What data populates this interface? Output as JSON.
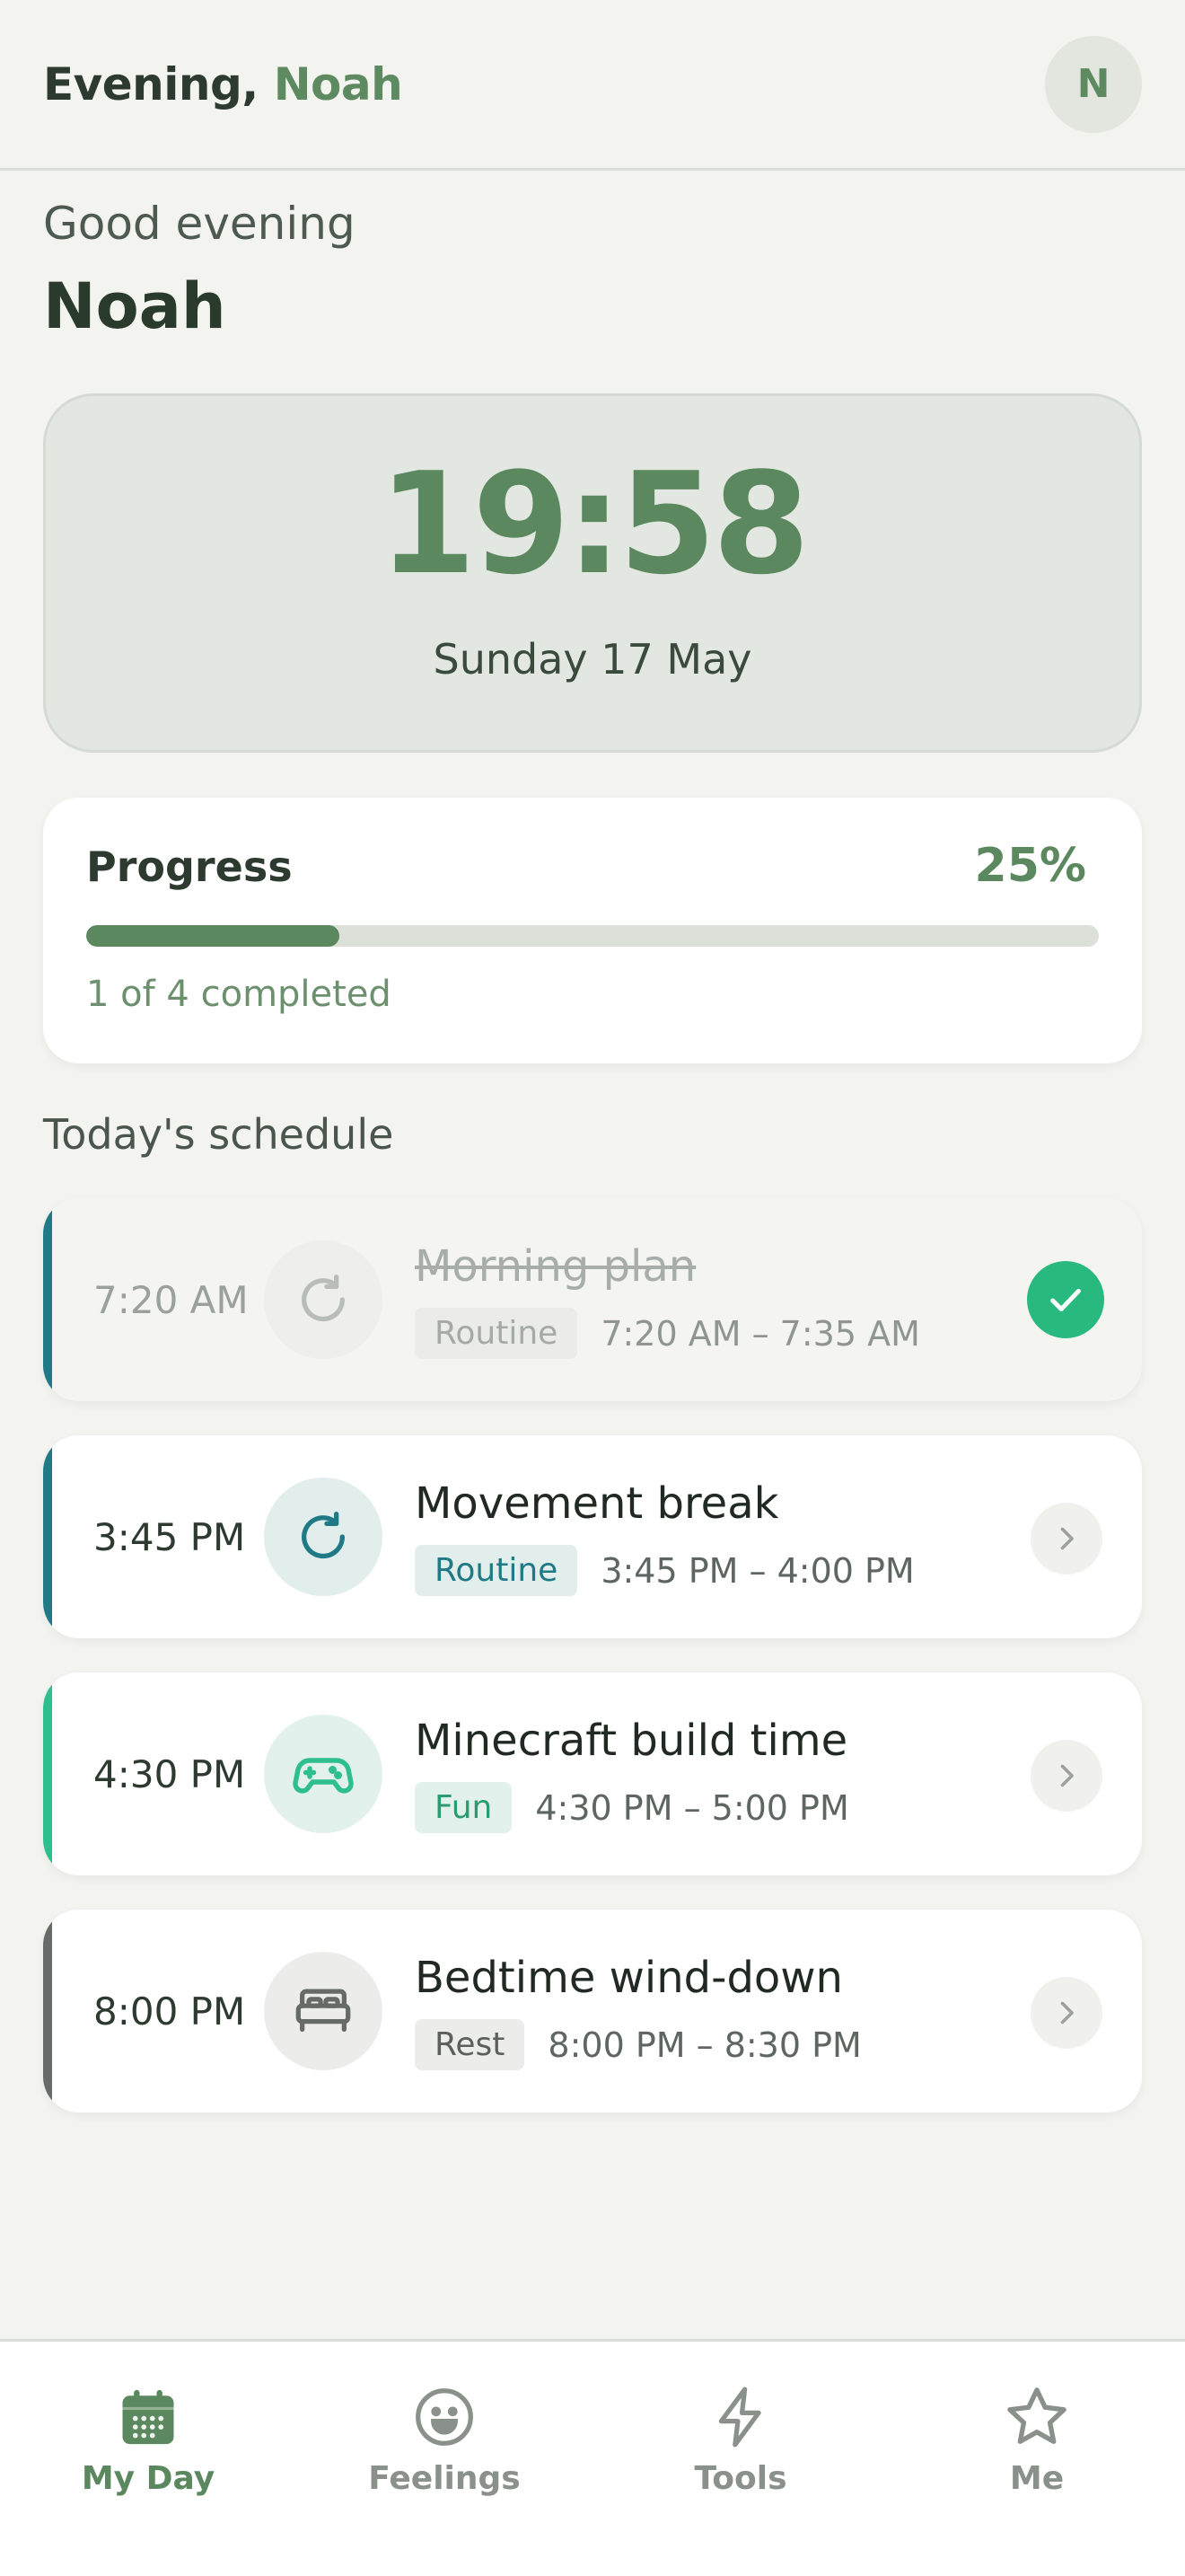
{
  "header": {
    "greeting_prefix": "Evening, ",
    "user_name": "Noah",
    "avatar_initial": "N"
  },
  "greeting": {
    "subtitle": "Good evening",
    "name": "Noah"
  },
  "clock": {
    "time": "19:58",
    "date": "Sunday 17 May"
  },
  "progress": {
    "label": "Progress",
    "percent_text": "25%",
    "fraction": 0.25,
    "note": "1 of 4 completed"
  },
  "schedule": {
    "title": "Today's schedule",
    "items": [
      {
        "time": "7:20 AM",
        "title": "Morning plan",
        "tag": "Routine",
        "range": "7:20 AM – 7:35 AM",
        "completed": true,
        "icon": "refresh-icon",
        "accent": "#1f7a86"
      },
      {
        "time": "3:45 PM",
        "title": "Movement break",
        "tag": "Routine",
        "range": "3:45 PM – 4:00 PM",
        "completed": false,
        "icon": "refresh-icon",
        "accent": "#1f7a86"
      },
      {
        "time": "4:30 PM",
        "title": "Minecraft build time",
        "tag": "Fun",
        "range": "4:30 PM – 5:00 PM",
        "completed": false,
        "icon": "gamepad-icon",
        "accent": "#2fbf8f"
      },
      {
        "time": "8:00 PM",
        "title": "Bedtime wind-down",
        "tag": "Rest",
        "range": "8:00 PM – 8:30 PM",
        "completed": false,
        "icon": "bed-icon",
        "accent": "#666b68"
      }
    ]
  },
  "nav": {
    "items": [
      {
        "label": "My Day",
        "icon": "calendar-icon",
        "active": true
      },
      {
        "label": "Feelings",
        "icon": "smiley-icon",
        "active": false
      },
      {
        "label": "Tools",
        "icon": "lightning-icon",
        "active": false
      },
      {
        "label": "Me",
        "icon": "star-icon",
        "active": false
      }
    ]
  },
  "colors": {
    "brand": "#5b885e",
    "background": "#f3f3ef",
    "check": "#28b97f"
  }
}
